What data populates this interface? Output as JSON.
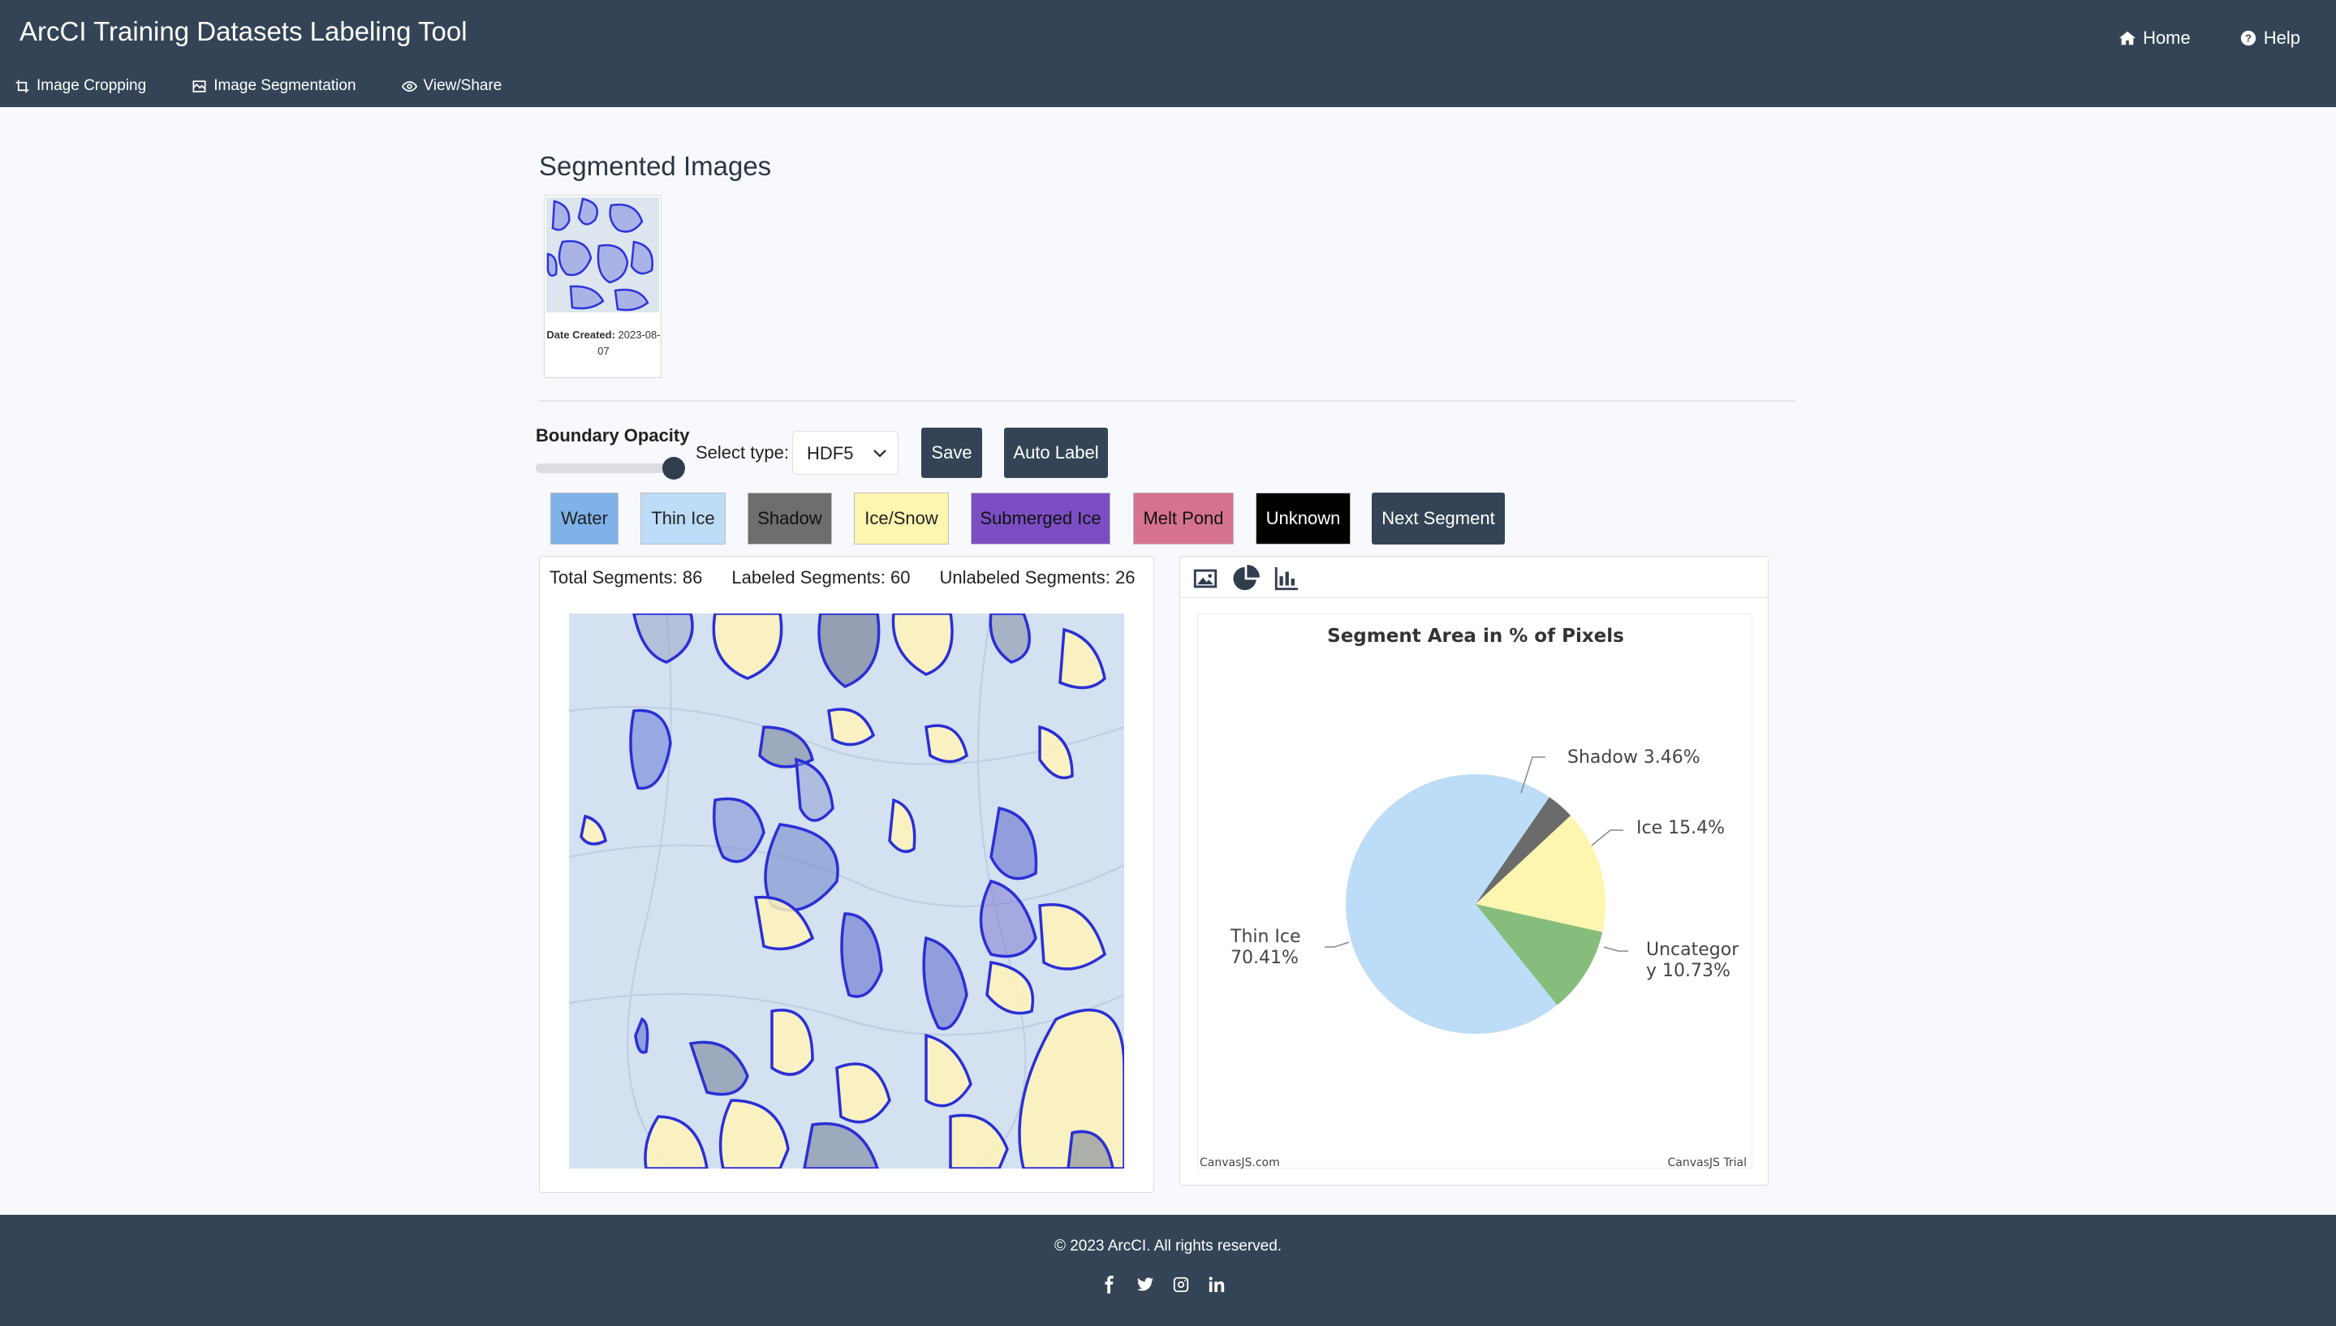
{
  "app": {
    "title": "ArcCI Training Datasets Labeling Tool"
  },
  "top_nav": {
    "home": "Home",
    "help": "Help"
  },
  "sub_nav": {
    "cropping": "Image Cropping",
    "segmentation": "Image Segmentation",
    "view_share": "View/Share"
  },
  "segmented_images": {
    "title": "Segmented Images",
    "items": [
      {
        "date_label": "Date Created:",
        "date_value": "2023-08-07"
      }
    ]
  },
  "controls": {
    "opacity_label": "Boundary Opacity",
    "opacity_value": 1.0,
    "type_label": "Select type:",
    "type_value": "HDF5",
    "save_label": "Save",
    "auto_label": "Auto Label",
    "next_segment": "Next Segment"
  },
  "labels": [
    {
      "name": "Water",
      "color": "#7fb2e8",
      "text_color": "#222222"
    },
    {
      "name": "Thin Ice",
      "color": "#bcdcf7",
      "text_color": "#222222"
    },
    {
      "name": "Shadow",
      "color": "#6e6e6e",
      "text_color": "#111111"
    },
    {
      "name": "Ice/Snow",
      "color": "#fdf5b0",
      "text_color": "#222222"
    },
    {
      "name": "Submerged Ice",
      "color": "#7c4ec3",
      "text_color": "#111111"
    },
    {
      "name": "Melt Pond",
      "color": "#d6738e",
      "text_color": "#111111"
    },
    {
      "name": "Unknown",
      "color": "#000000",
      "text_color": "#ffffff"
    }
  ],
  "stats": {
    "total": "Total Segments: 86",
    "labeled": "Labeled Segments: 60",
    "unlabeled": "Unlabeled Segments: 26"
  },
  "chart_toolbar": [
    "image-icon",
    "pie-chart-icon",
    "bar-chart-icon"
  ],
  "chart_data": {
    "type": "pie",
    "title": "Segment Area in % of Pixels",
    "slices": [
      {
        "label": "Shadow",
        "value": 3.46,
        "display": "Shadow 3.46%",
        "color": "#6b6b6b"
      },
      {
        "label": "Ice",
        "value": 15.4,
        "display": "Ice 15.4%",
        "color": "#fdf5b0"
      },
      {
        "label": "Uncategory",
        "value": 10.73,
        "display": "Uncategory 10.73%",
        "color": "#86bd7c"
      },
      {
        "label": "Thin Ice",
        "value": 70.41,
        "display": "Thin Ice 70.41%",
        "color": "#bcdcf7"
      }
    ],
    "label_lines": {
      "shadow": "Shadow 3.46%",
      "ice": "Ice 15.4%",
      "uncat_1": "Uncategor",
      "uncat_2": "y 10.73%",
      "thin_1": "Thin Ice",
      "thin_2": "70.41%"
    },
    "credit_left": "CanvasJS.com",
    "credit_right": "CanvasJS Trial"
  },
  "footer": {
    "copyright": "© 2023 ArcCI. All rights reserved."
  },
  "social": [
    "facebook-icon",
    "twitter-icon",
    "instagram-icon",
    "linkedin-icon"
  ]
}
